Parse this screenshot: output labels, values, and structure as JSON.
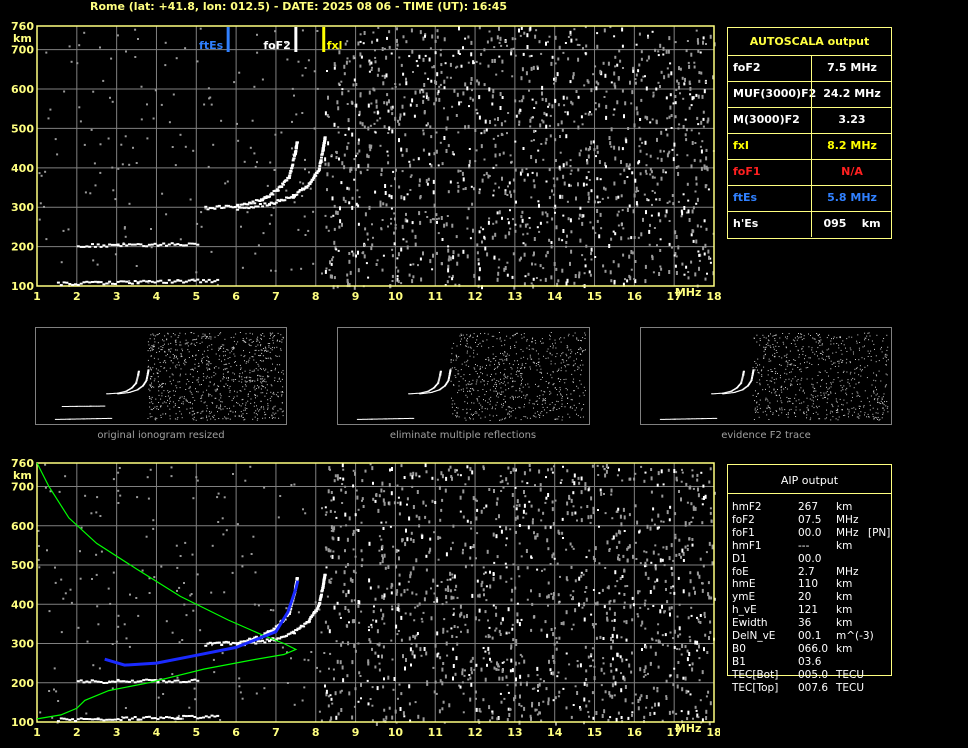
{
  "title": "Rome (lat: +41.8, lon: 012.5) - DATE: 2025 08 06 - TIME (UT): 16:45",
  "colors": {
    "frame": "#ffff80",
    "grid": "#808080",
    "fxl": "#ffff00",
    "ftes": "#3080ff",
    "fof1": "#ff2020",
    "model": "#00ff00",
    "trace": "#1a2aff"
  },
  "chart_data": [
    {
      "type": "scatter",
      "name": "ionogram",
      "xlabel": "MHz",
      "ylabel": "km",
      "xlim": [
        1,
        18
      ],
      "ylim": [
        100,
        760
      ],
      "x_ticks": [
        "1",
        "2",
        "3",
        "4",
        "5",
        "6",
        "7",
        "8",
        "9",
        "10",
        "11",
        "12",
        "13",
        "14",
        "15",
        "16",
        "17",
        "18"
      ],
      "y_ticks": [
        "100",
        "200",
        "300",
        "400",
        "500",
        "600",
        "700",
        "760"
      ],
      "markers": [
        {
          "label": "ftEs",
          "x": 5.8,
          "color": "#3080ff"
        },
        {
          "label": "foF2",
          "x": 7.5,
          "color": "#ffffff"
        },
        {
          "label": "fxl",
          "x": 8.2,
          "color": "#ffff00"
        }
      ],
      "traces": [
        {
          "name": "Es",
          "points": [
            [
              1.5,
              108
            ],
            [
              2.5,
              110
            ],
            [
              3.5,
              112
            ],
            [
              4.5,
              114
            ],
            [
              5.5,
              116
            ]
          ]
        },
        {
          "name": "Es-multiple",
          "points": [
            [
              2.0,
              205
            ],
            [
              3.0,
              206
            ],
            [
              4.0,
              207
            ],
            [
              5.0,
              208
            ]
          ]
        },
        {
          "name": "F2-O",
          "points": [
            [
              5.2,
              300
            ],
            [
              6.0,
              305
            ],
            [
              6.6,
              320
            ],
            [
              7.0,
              345
            ],
            [
              7.3,
              380
            ],
            [
              7.45,
              440
            ],
            [
              7.5,
              470
            ]
          ]
        },
        {
          "name": "F2-X",
          "points": [
            [
              6.0,
              300
            ],
            [
              6.8,
              310
            ],
            [
              7.4,
              330
            ],
            [
              7.8,
              360
            ],
            [
              8.05,
              400
            ],
            [
              8.15,
              450
            ],
            [
              8.2,
              480
            ]
          ]
        }
      ]
    },
    {
      "type": "line",
      "name": "aip-profile",
      "xlabel": "MHz",
      "ylabel": "km",
      "xlim": [
        1,
        18
      ],
      "ylim": [
        100,
        760
      ],
      "x_ticks": [
        "1",
        "2",
        "3",
        "4",
        "5",
        "6",
        "7",
        "8",
        "9",
        "10",
        "11",
        "12",
        "13",
        "14",
        "15",
        "16",
        "17",
        "18"
      ],
      "y_ticks": [
        "100",
        "200",
        "300",
        "400",
        "500",
        "600",
        "700",
        "760"
      ],
      "series": [
        {
          "points": [
            [
              1.0,
              760
            ],
            [
              1.3,
              700
            ],
            [
              1.8,
              620
            ],
            [
              2.5,
              555
            ],
            [
              3.5,
              490
            ],
            [
              4.6,
              420
            ],
            [
              5.8,
              360
            ],
            [
              6.7,
              320
            ],
            [
              7.2,
              300
            ],
            [
              7.5,
              285
            ],
            [
              7.2,
              272
            ],
            [
              6.4,
              258
            ],
            [
              5.2,
              235
            ],
            [
              3.8,
              200
            ],
            [
              2.8,
              180
            ],
            [
              2.2,
              155
            ],
            [
              2.0,
              135
            ],
            [
              1.6,
              118
            ],
            [
              1.0,
              108
            ]
          ]
        },
        {
          "points": [
            [
              2.7,
              260
            ],
            [
              3.2,
              245
            ],
            [
              4.0,
              250
            ],
            [
              5.0,
              270
            ],
            [
              6.0,
              290
            ],
            [
              7.0,
              330
            ],
            [
              7.3,
              380
            ],
            [
              7.5,
              440
            ],
            [
              7.55,
              460
            ]
          ]
        }
      ]
    }
  ],
  "thumbnails": [
    {
      "caption": "original ionogram resized"
    },
    {
      "caption": "eliminate multiple reflections"
    },
    {
      "caption": "evidence F2 trace"
    }
  ],
  "autoscala": {
    "header": "AUTOSCALA output",
    "rows": [
      {
        "label": "foF2",
        "value": "7.5 MHz",
        "color": "#ffffff"
      },
      {
        "label": "MUF(3000)F2",
        "value": "24.2 MHz",
        "color": "#ffffff"
      },
      {
        "label": "M(3000)F2",
        "value": "3.23",
        "color": "#ffffff"
      },
      {
        "label": "fxI",
        "value": "8.2 MHz",
        "color": "#ffff00"
      },
      {
        "label": "foF1",
        "value": "N/A",
        "color": "#ff2020"
      },
      {
        "label": "ftEs",
        "value": "5.8 MHz",
        "color": "#3080ff"
      },
      {
        "label": "h'Es",
        "value": "095    km",
        "color": "#ffffff"
      }
    ]
  },
  "aip": {
    "header": "AIP output",
    "rows": [
      {
        "name": "hmF2",
        "value": "267",
        "unit": "km",
        "extra": ""
      },
      {
        "name": "foF2",
        "value": "07.5",
        "unit": "MHz",
        "extra": ""
      },
      {
        "name": "foF1",
        "value": "00.0",
        "unit": "MHz",
        "extra": "[PN]"
      },
      {
        "name": "hmF1",
        "value": "---",
        "unit": "km",
        "extra": ""
      },
      {
        "name": "D1",
        "value": "00.0",
        "unit": "",
        "extra": ""
      },
      {
        "name": "foE",
        "value": "2.7",
        "unit": "MHz",
        "extra": ""
      },
      {
        "name": "hmE",
        "value": "110",
        "unit": "km",
        "extra": ""
      },
      {
        "name": "ymE",
        "value": "20",
        "unit": "km",
        "extra": ""
      },
      {
        "name": "h_vE",
        "value": "121",
        "unit": "km",
        "extra": ""
      },
      {
        "name": "Ewidth",
        "value": "36",
        "unit": "km",
        "extra": ""
      },
      {
        "name": "DelN_vE",
        "value": "00.1",
        "unit": "m^(-3)",
        "extra": ""
      },
      {
        "name": "B0",
        "value": "066.0",
        "unit": "km",
        "extra": ""
      },
      {
        "name": "B1",
        "value": "03.6",
        "unit": "",
        "extra": ""
      },
      {
        "name": "TEC[Bot]",
        "value": "005.0",
        "unit": "TECU",
        "extra": ""
      },
      {
        "name": "TEC[Top]",
        "value": "007.6",
        "unit": "TECU",
        "extra": ""
      }
    ]
  }
}
